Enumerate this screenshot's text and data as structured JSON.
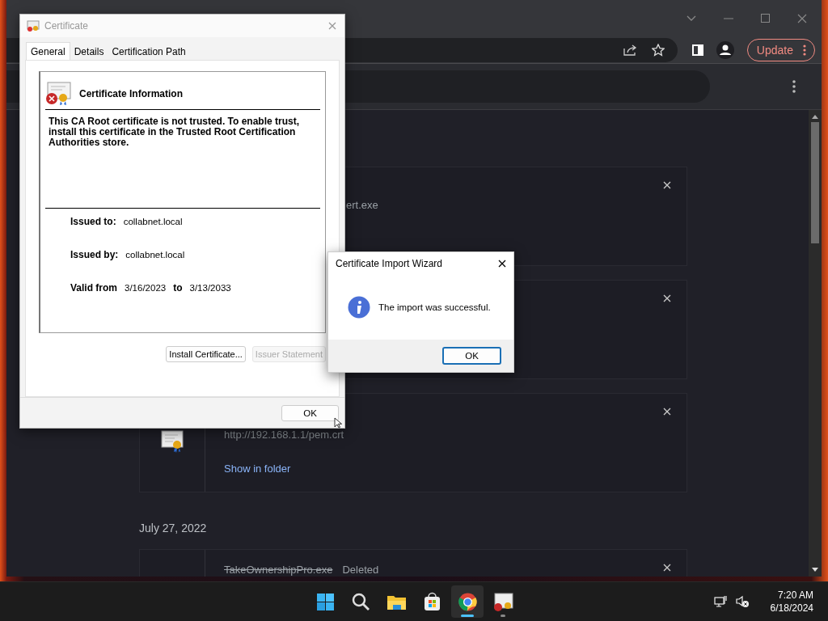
{
  "browser": {
    "toolbar": {
      "update_button": "Update"
    },
    "downloads": [
      {
        "kind": "card",
        "file_name": "ert.exe"
      },
      {
        "kind": "card"
      },
      {
        "kind": "card",
        "url": "http://192.168.1.1/pem.crt",
        "link": "Show in folder",
        "thumbnail": true
      },
      {
        "kind": "date",
        "text": "July 27, 2022"
      },
      {
        "kind": "card",
        "file_name": "TakeOwnershipPro.exe",
        "status": "Deleted",
        "deleted": true,
        "thumbnail": false
      }
    ]
  },
  "certificate_dialog": {
    "title": "Certificate",
    "tabs": [
      {
        "label": "General",
        "selected": true
      },
      {
        "label": "Details",
        "selected": false
      },
      {
        "label": "Certification Path",
        "selected": false
      }
    ],
    "heading": "Certificate Information",
    "message": "This CA Root certificate is not trusted. To enable trust, install this certificate in the Trusted Root Certification Authorities store.",
    "issued_to_label": "Issued to:",
    "issued_to": "collabnet.local",
    "issued_by_label": "Issued by:",
    "issued_by": "collabnet.local",
    "valid_from_label": "Valid from",
    "valid_from": "3/16/2023",
    "to_label": "to",
    "valid_to": "3/13/2033",
    "buttons": [
      {
        "label": "Install Certificate...",
        "disabled": false
      },
      {
        "label": "Issuer Statement",
        "disabled": true
      }
    ],
    "ok_button": {
      "label": "OK",
      "focused": false
    }
  },
  "import_wizard": {
    "title": "Certificate Import Wizard",
    "message": "The import was successful.",
    "ok_button": {
      "label": "OK",
      "focused": true
    }
  },
  "taskbar": {
    "apps": [
      {
        "kind": "start",
        "active": false,
        "running": false
      },
      {
        "kind": "search",
        "active": false,
        "running": false
      },
      {
        "kind": "folder",
        "active": false,
        "running": false
      },
      {
        "kind": "store",
        "active": false,
        "running": false
      },
      {
        "kind": "browser",
        "active": true,
        "running": true
      },
      {
        "kind": "certificate",
        "active": false,
        "running": true
      }
    ],
    "time": "7:20 AM",
    "date": "6/18/2024"
  }
}
